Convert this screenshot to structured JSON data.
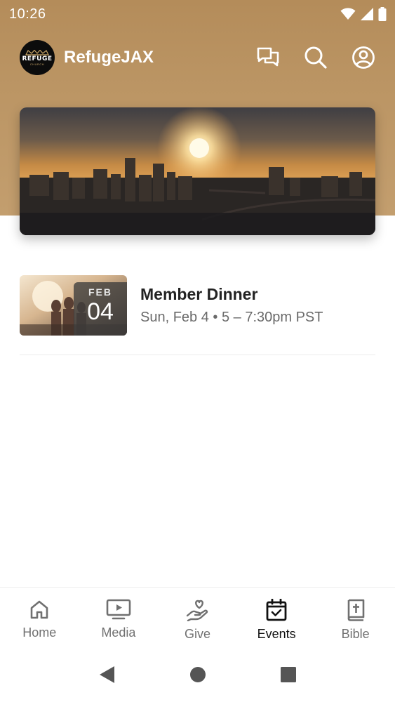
{
  "status_bar": {
    "time": "10:26"
  },
  "app_bar": {
    "title": "RefugeJAX",
    "logo": {
      "text": "REFUGE",
      "subtext": "CHURCH",
      "accent": "#c9a567"
    },
    "actions": [
      {
        "name": "chat-icon"
      },
      {
        "name": "search-icon"
      },
      {
        "name": "account-icon"
      }
    ]
  },
  "colors": {
    "header_background": "#bb9564",
    "active_nav": "#111111",
    "inactive_nav": "#707070"
  },
  "events": [
    {
      "title": "Member Dinner",
      "date_month": "FEB",
      "date_day": "04",
      "meta": "Sun, Feb 4 • 5 – 7:30pm PST"
    }
  ],
  "bottom_nav": {
    "items": [
      {
        "label": "Home",
        "icon": "home-icon",
        "active": false
      },
      {
        "label": "Media",
        "icon": "media-icon",
        "active": false
      },
      {
        "label": "Give",
        "icon": "give-icon",
        "active": false
      },
      {
        "label": "Events",
        "icon": "calendar-icon",
        "active": true
      },
      {
        "label": "Bible",
        "icon": "bible-icon",
        "active": false
      }
    ]
  }
}
